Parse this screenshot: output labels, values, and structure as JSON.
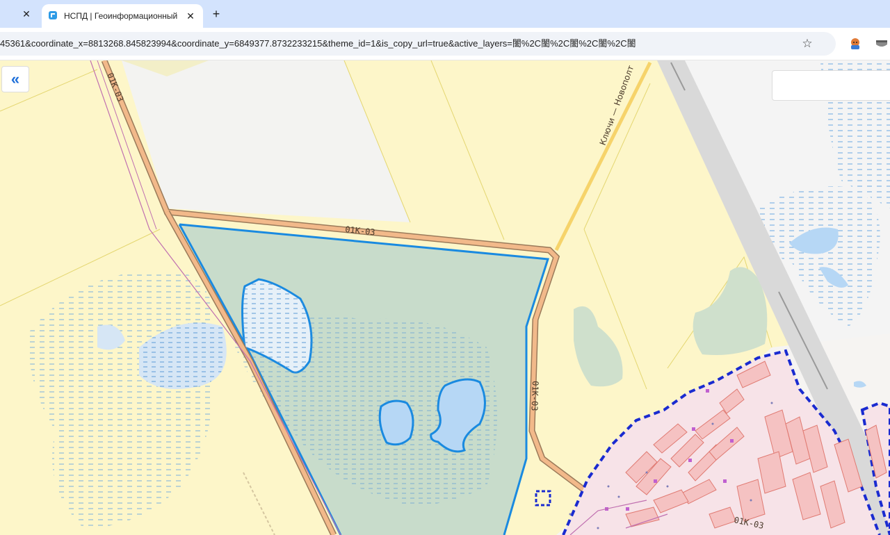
{
  "browser": {
    "prev_tab_close": "✕",
    "active_tab": {
      "title": "НСПД | Геоинформационный",
      "close": "✕"
    },
    "new_tab": "+",
    "url": "45361&coordinate_x=8813268.845823994&coordinate_y=6849377.8732233215&theme_id=1&is_copy_url=true&active_layers=䦦%2C䦦%2C䦦%2C䦦%2C䦦",
    "bookmark_icon": "☆"
  },
  "map": {
    "collapse_label": "«",
    "road_labels": [
      "01К-03",
      "01К-03",
      "01К-03",
      "01К-03",
      "01К-03",
      "Ключи — Новополт"
    ],
    "colors": {
      "agri_land": "#fdf6c9",
      "empty_land": "#f4f4f4",
      "parcel_fill": "#c8dccb",
      "parcel_border": "#1a8ae0",
      "water": "#b6d7f5",
      "wetland_dash": "#5aa0e0",
      "settlement_fill": "#f9dada",
      "settlement_border": "#1a2bd0",
      "building": "#e07a72",
      "road_outline": "#9a7a5a",
      "road_fill": "#f2b98a",
      "highway": "#d9d9d9",
      "forest": "#cfe0cc"
    }
  }
}
